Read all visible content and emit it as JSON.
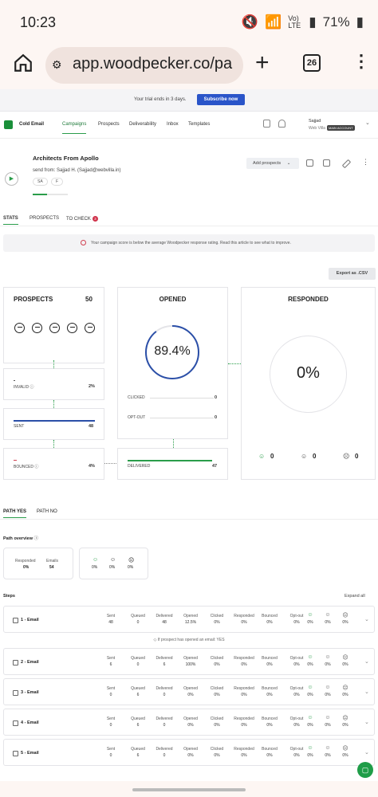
{
  "status_bar": {
    "time": "10:23",
    "battery": "71%",
    "net": "Vo) LTE"
  },
  "browser": {
    "url": "app.woodpecker.co/pa",
    "tab_count": "26",
    "plus": "+",
    "more": "⋮"
  },
  "trial": {
    "message": "Your trial ends in 3 days.",
    "button": "Subscribe now"
  },
  "nav": {
    "brand": "Cold Email",
    "items": [
      "Campaigns",
      "Prospects",
      "Deliverability",
      "Inbox",
      "Templates"
    ],
    "user_name": "Sajjad",
    "user_org": "Web Villa",
    "user_badge": "MAIN ACCOUNT"
  },
  "campaign": {
    "title": "Architects From Apollo",
    "send_from": "send from:  Sajjad H.  (Sajjad@webvilla.in)",
    "tags": [
      "SA",
      "F"
    ],
    "add_prospects": "Add prospects"
  },
  "stats_tabs": {
    "stats": "STATS",
    "prospects": "PROSPECTS",
    "to_check": "TO CHECK",
    "to_check_count": "3"
  },
  "score_note": "Your campaign score is below the average Woodpecker response rating. Read this article to see what to improve.",
  "export_button": "Export as .CSV",
  "prospects_card": {
    "title": "PROSPECTS",
    "total": "50",
    "invalid_label": "INVALID",
    "invalid_value": "2%",
    "sent_label": "SENT",
    "sent_value": "48",
    "bounced_label": "BOUNCED",
    "bounced_value": "4%"
  },
  "opened_card": {
    "title": "OPENED",
    "percent": "89.4%",
    "percent_fraction": 0.894,
    "clicked_label": "CLICKED",
    "clicked_value": "0",
    "optout_label": "OPT-OUT",
    "optout_value": "0",
    "delivered_label": "DELIVERED",
    "delivered_value": "47"
  },
  "responded_card": {
    "title": "RESPONDED",
    "percent": "0%",
    "positive": "0",
    "neutral": "0",
    "negative": "0"
  },
  "path_tabs": {
    "yes": "PATH YES",
    "no": "PATH NO"
  },
  "path_overview": {
    "title": "Path overview",
    "responded_label": "Responded",
    "responded_value": "0%",
    "emails_label": "Emails",
    "emails_value": "54",
    "sent_pct": [
      "0%",
      "0%",
      "0%"
    ]
  },
  "steps_section": {
    "title": "Steps",
    "expand_all": "Expand all",
    "condition": "If prospect has opened an email: YES"
  },
  "step_columns": [
    "Sent",
    "Queued",
    "Delivered",
    "Opened",
    "Clicked",
    "Responded",
    "Bounced",
    "Opt-out"
  ],
  "steps": [
    {
      "name": "1 - Email",
      "values": [
        "48",
        "0",
        "48",
        "12.5%",
        "0%",
        "0%",
        "0%",
        "0%",
        "0%",
        "0%",
        "0%"
      ]
    },
    {
      "name": "2 - Email",
      "values": [
        "6",
        "0",
        "6",
        "100%",
        "0%",
        "0%",
        "0%",
        "0%",
        "0%",
        "0%",
        "0%"
      ]
    },
    {
      "name": "3 - Email",
      "values": [
        "0",
        "6",
        "0",
        "0%",
        "0%",
        "0%",
        "0%",
        "0%",
        "0%",
        "0%",
        "0%"
      ]
    },
    {
      "name": "4 - Email",
      "values": [
        "0",
        "6",
        "0",
        "0%",
        "0%",
        "0%",
        "0%",
        "0%",
        "0%",
        "0%",
        "0%"
      ]
    },
    {
      "name": "5 - Email",
      "values": [
        "0",
        "6",
        "0",
        "0%",
        "0%",
        "0%",
        "0%",
        "0%",
        "0%",
        "0%",
        "0%"
      ]
    }
  ],
  "colors": {
    "accent": "#2a9d4a",
    "primary": "#2a55c9",
    "opened_ring": "#2b4fa8"
  }
}
